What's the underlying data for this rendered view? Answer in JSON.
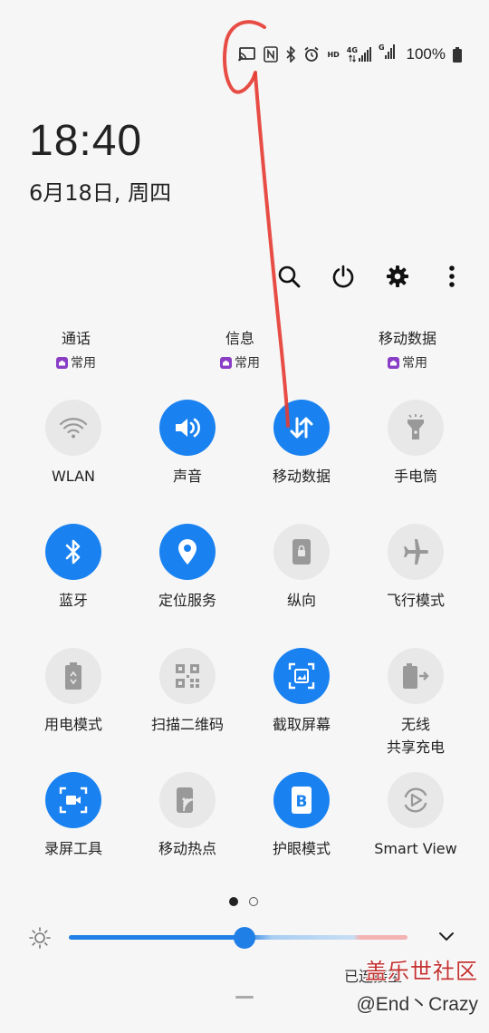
{
  "status_bar": {
    "battery_percent_text": "100%",
    "hd_label": "HD",
    "network_label": "4G",
    "sim2_label": "G",
    "icons": [
      "cast-icon",
      "nfc-icon",
      "bluetooth-icon",
      "alarm-icon",
      "hd-volte-icon",
      "signal-4g-icon",
      "signal-g-icon",
      "battery-icon"
    ]
  },
  "clock": {
    "time": "18:40",
    "date": "6月18日, 周四"
  },
  "top_actions": [
    "search-icon",
    "power-icon",
    "settings-icon",
    "more-icon"
  ],
  "shortcuts": [
    {
      "name": "通话",
      "tag": "常用"
    },
    {
      "name": "信息",
      "tag": "常用"
    },
    {
      "name": "移动数据",
      "tag": "常用"
    }
  ],
  "tiles": [
    {
      "label": "WLAN",
      "on": false,
      "icon": "wifi-icon"
    },
    {
      "label": "声音",
      "on": true,
      "icon": "sound-icon"
    },
    {
      "label": "移动数据",
      "on": true,
      "icon": "mobile-data-icon"
    },
    {
      "label": "手电筒",
      "on": false,
      "icon": "flashlight-icon"
    },
    {
      "label": "蓝牙",
      "on": true,
      "icon": "bluetooth-icon"
    },
    {
      "label": "定位服务",
      "on": true,
      "icon": "location-icon"
    },
    {
      "label": "纵向",
      "on": false,
      "icon": "portrait-lock-icon"
    },
    {
      "label": "飞行模式",
      "on": false,
      "icon": "airplane-icon"
    },
    {
      "label": "用电模式",
      "on": false,
      "icon": "power-mode-icon"
    },
    {
      "label": "扫描二维码",
      "on": false,
      "icon": "qr-code-icon"
    },
    {
      "label": "截取屏幕",
      "on": true,
      "icon": "screenshot-icon"
    },
    {
      "label": "无线\n共享充电",
      "on": false,
      "icon": "wireless-share-icon"
    },
    {
      "label": "录屏工具",
      "on": true,
      "icon": "screen-record-icon"
    },
    {
      "label": "移动热点",
      "on": false,
      "icon": "hotspot-icon"
    },
    {
      "label": "护眼模式",
      "on": true,
      "icon": "eye-comfort-icon"
    },
    {
      "label": "Smart View",
      "on": false,
      "icon": "smart-view-icon"
    }
  ],
  "pager": {
    "current": 1,
    "total": 2
  },
  "brightness": {
    "level": 0.52
  },
  "watermark": {
    "site": "盖乐世社区",
    "author": "@End丶Crazy",
    "partial": "已连接至"
  },
  "colors": {
    "accent": "#1a82f0",
    "tile_off": "#e8e8e8",
    "annotation": "#e53b32",
    "shortcut_tag": "#8a3ec6"
  }
}
